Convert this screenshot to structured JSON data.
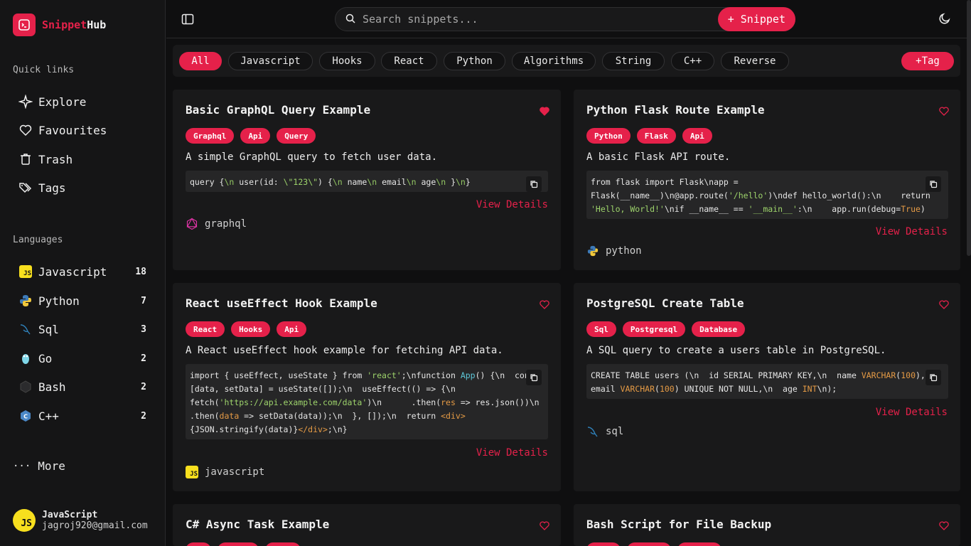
{
  "app": {
    "name_part1": "Snippet",
    "name_part2": "Hub"
  },
  "sidebar": {
    "quick_links_label": "Quick links",
    "quick_links": [
      {
        "label": "Explore",
        "icon": "sparkle-icon"
      },
      {
        "label": "Favourites",
        "icon": "heart-icon"
      },
      {
        "label": "Trash",
        "icon": "trash-icon"
      },
      {
        "label": "Tags",
        "icon": "tags-icon"
      }
    ],
    "languages_label": "Languages",
    "languages": [
      {
        "label": "Javascript",
        "count": "18",
        "icon": "javascript-icon"
      },
      {
        "label": "Python",
        "count": "7",
        "icon": "python-icon"
      },
      {
        "label": "Sql",
        "count": "3",
        "icon": "sql-icon"
      },
      {
        "label": "Go",
        "count": "2",
        "icon": "go-icon"
      },
      {
        "label": "Bash",
        "count": "2",
        "icon": "bash-icon"
      },
      {
        "label": "C++",
        "count": "2",
        "icon": "cpp-icon"
      }
    ],
    "more_label": "More",
    "user": {
      "name": "JavaScript",
      "email": "jagroj920@gmail.com",
      "avatar_text": "JS"
    }
  },
  "topbar": {
    "search_placeholder": "Search snippets...",
    "add_snippet_label": "+ Snippet"
  },
  "tags": {
    "items": [
      "All",
      "Javascript",
      "Hooks",
      "React",
      "Python",
      "Algorithms",
      "String",
      "C++",
      "Reverse"
    ],
    "active": "All",
    "add_label": "+Tag"
  },
  "colors": {
    "accent": "#e5214a",
    "background": "#0f0f10",
    "card": "#19191a"
  },
  "cards": [
    {
      "title": "Basic GraphQL Query Example",
      "favourite": true,
      "tags": [
        "Graphql",
        "Api",
        "Query"
      ],
      "description": "A simple GraphQL query to fetch user data.",
      "view_label": "View Details",
      "language": "graphql"
    },
    {
      "title": "Python Flask Route Example",
      "favourite": false,
      "tags": [
        "Python",
        "Flask",
        "Api"
      ],
      "description": "A basic Flask API route.",
      "view_label": "View Details",
      "language": "python"
    },
    {
      "title": "React useEffect Hook Example",
      "favourite": false,
      "tags": [
        "React",
        "Hooks",
        "Api"
      ],
      "description": "A React useEffect hook example for fetching API data.",
      "view_label": "View Details",
      "language": "javascript"
    },
    {
      "title": "PostgreSQL Create Table",
      "favourite": false,
      "tags": [
        "Sql",
        "Postgresql",
        "Database"
      ],
      "description": "A SQL query to create a users table in PostgreSQL.",
      "view_label": "View Details",
      "language": "sql"
    },
    {
      "title": "C# Async Task Example",
      "favourite": false
    },
    {
      "title": "Bash Script for File Backup",
      "favourite": false
    }
  ]
}
